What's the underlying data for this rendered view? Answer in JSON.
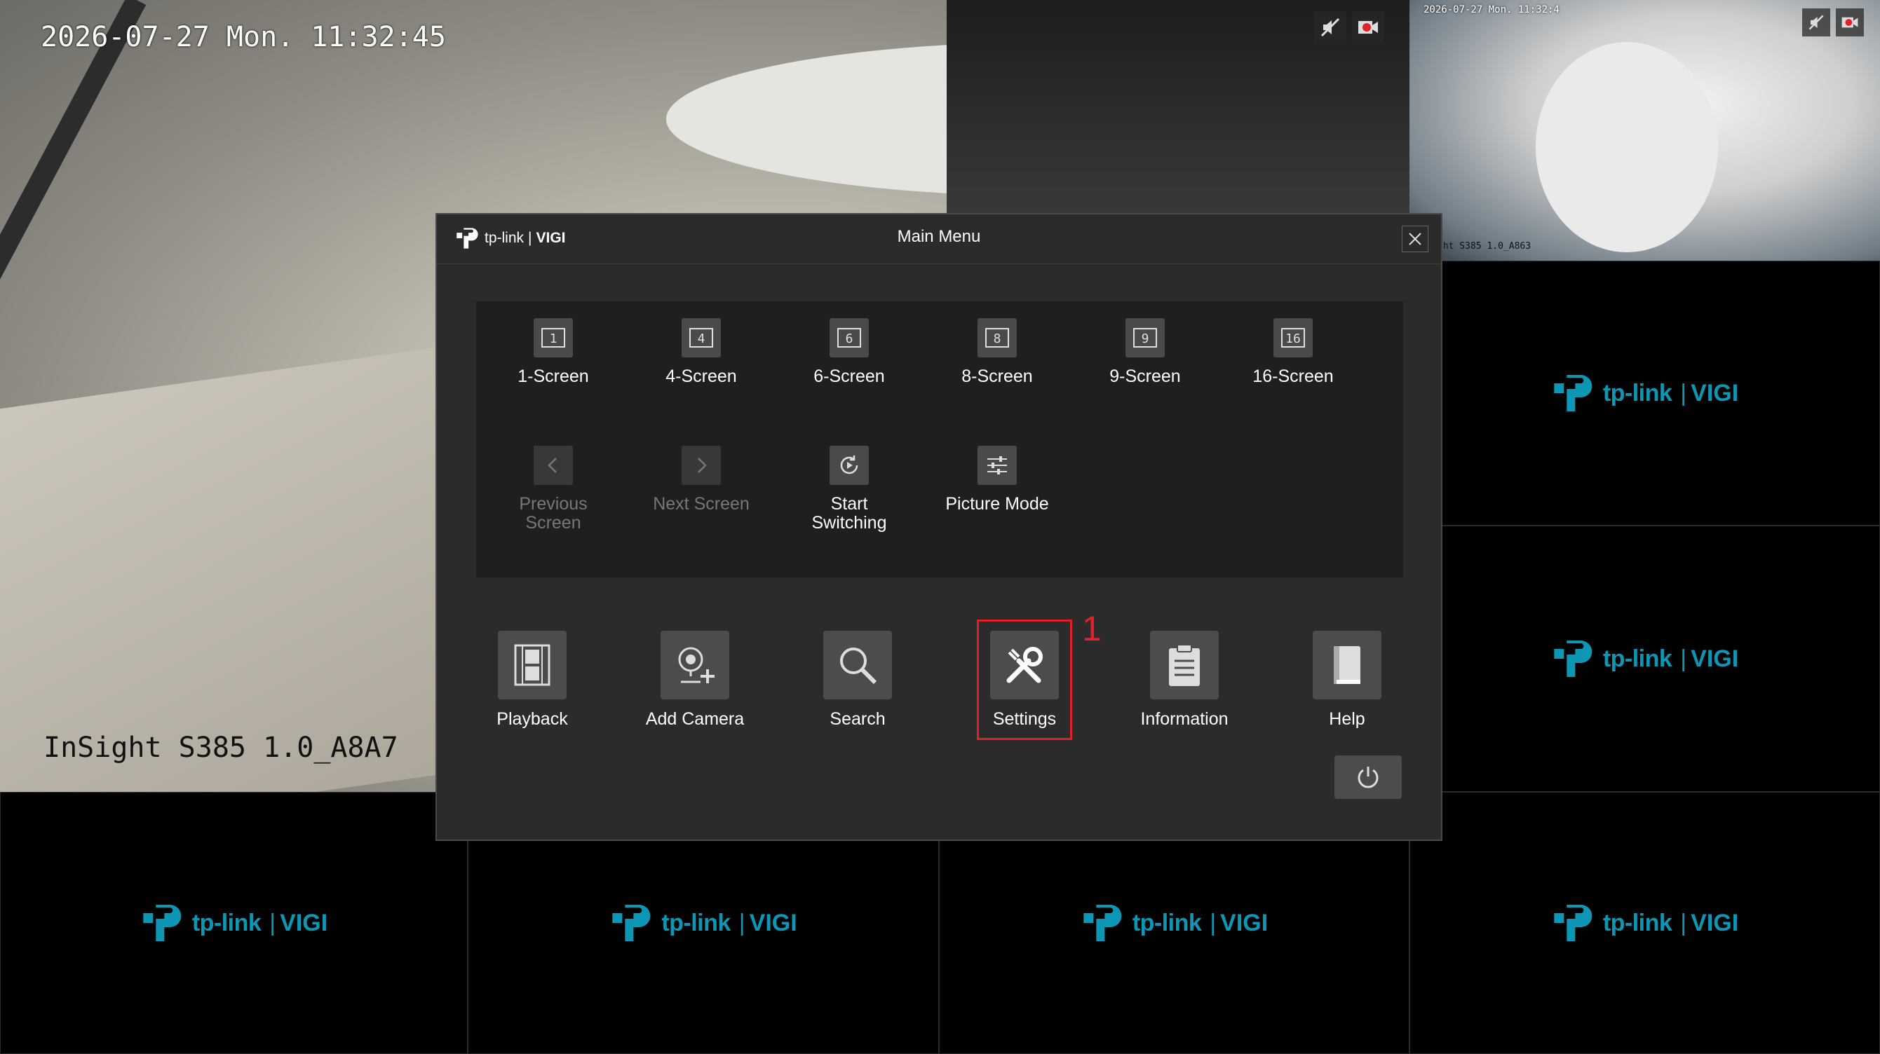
{
  "camera_main": {
    "timestamp": "2026-07-27 Mon. 11:32:45",
    "name": "InSight S385 1.0_A8A7"
  },
  "camera_small": {
    "timestamp": "2026-07-27 Mon. 11:32:4",
    "name": "ght S385 1.0_A863"
  },
  "logo": {
    "brand": "tp-link",
    "separator": "|",
    "product": "VIGI"
  },
  "dialog": {
    "brand": "tp-link",
    "brand_sep": "|",
    "brand_product": "VIGI",
    "title": "Main Menu"
  },
  "screen_layouts": [
    {
      "label": "1-Screen",
      "num": "1"
    },
    {
      "label": "4-Screen",
      "num": "4"
    },
    {
      "label": "6-Screen",
      "num": "6"
    },
    {
      "label": "8-Screen",
      "num": "8"
    },
    {
      "label": "9-Screen",
      "num": "9"
    },
    {
      "label": "16-Screen",
      "num": "16"
    }
  ],
  "screen_actions": {
    "previous": "Previous Screen",
    "next": "Next Screen",
    "start_switching": "Start Switching",
    "picture_mode": "Picture Mode"
  },
  "functions": {
    "playback": "Playback",
    "add_camera": "Add Camera",
    "search": "Search",
    "settings": "Settings",
    "information": "Information",
    "help": "Help"
  },
  "annotation": {
    "step_number": "1"
  },
  "colors": {
    "accent": "#0d97b5",
    "highlight": "#e0202a",
    "dialog_bg": "#2b2b2b"
  }
}
